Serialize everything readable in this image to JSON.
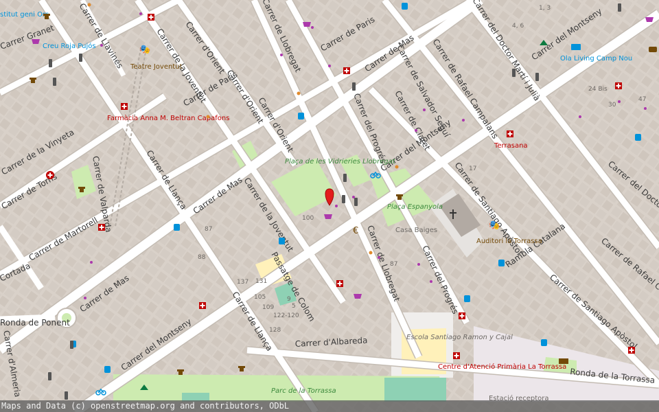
{
  "attribution": "Maps and Data (c) openstreetmap.org and contributors, ODbL",
  "streets": [
    "Carrer de Llavinés",
    "Carrer Granet",
    "Carrer de la Joventut",
    "Carrer de Paris",
    "Carrer d'Orient",
    "Carrer de Llobregat",
    "Carrer de Mas",
    "Carrer del Doctor Martí i Julià",
    "Carrer del Montseny",
    "Carrer de la Vinyeta",
    "Carrer de Torns",
    "Carrer de Valparda",
    "Carrer de Martorell",
    "Cortada",
    "Ronda de Ponent",
    "Carrer d'Almeria",
    "Carrer de Llança",
    "Carrer del Progrés",
    "Carrer de Claret",
    "Carrer de Salvador Seguí",
    "Carrer de Rafael Campalans",
    "Carrer de Santiago Apòstol",
    "Rambla Catalana",
    "Carrer d'Albareda",
    "Passatge de Colom",
    "Ronda de la Torrassa",
    "Carrer del Doctor Ma"
  ],
  "pois": {
    "creu_roja": "Creu Roja Pujós",
    "institut": "stitut geni Ors",
    "teatre": "Teatre Joventut",
    "farmacia": "Farmàcia Anna M. Beltran Capafons",
    "placa_vidrieries": "Plaça de les Vidrieries Llobregat",
    "placa_espanyola": "Plaça Espanyola",
    "casa_baiges": "Casa Baiges",
    "auditori": "Auditori la Torrassa",
    "terrasana": "Terrasana",
    "ola_living": "Ola Living Camp Nou",
    "escola": "Escola Santiago Ramon y Cajal",
    "centre": "Centre d'Atenció Primària La Torrassa",
    "parc": "Parc de la Torrassa",
    "estacio": "Estació receptora"
  },
  "numbers": [
    "1, 3",
    "4, 6",
    "24 Bis",
    "30",
    "47",
    "17",
    "100",
    "87",
    "88",
    "137",
    "131",
    "105",
    "109",
    "122-120",
    "9",
    "5",
    "128",
    "87"
  ],
  "colors": {
    "background": "#ddd8d3",
    "building": "#d1c9c1",
    "road": "#ffffff",
    "park": "#cdebb0",
    "pedestrian": "#f1f0ed",
    "school": "#fff1ba",
    "health_red": "#bf0000",
    "marker_red": "#e31c1c",
    "shop_purple": "#ac39ac",
    "transit_blue": "#0092da",
    "amenity_brown": "#734a08"
  }
}
